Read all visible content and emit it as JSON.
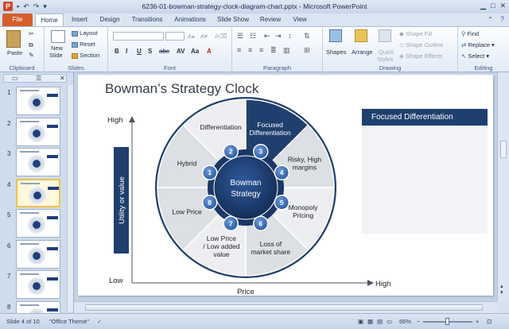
{
  "app": {
    "window_title": "6236-01-bowman-strategy-clock-diagram-chart.pptx - Microsoft PowerPoint",
    "logo": "P"
  },
  "tabs": [
    "File",
    "Home",
    "Insert",
    "Design",
    "Transitions",
    "Animations",
    "Slide Show",
    "Review",
    "View"
  ],
  "ribbon": {
    "clipboard": {
      "paste": "Paste",
      "group": "Clipboard"
    },
    "slides": {
      "new_slide_1": "New",
      "new_slide_2": "Slide",
      "layout": "Layout",
      "reset": "Reset",
      "section": "Section",
      "group": "Slides"
    },
    "font": {
      "group": "Font"
    },
    "paragraph": {
      "group": "Paragraph"
    },
    "drawing": {
      "shapes": "Shapes",
      "arrange": "Arrange",
      "quick_styles_1": "Quick",
      "quick_styles_2": "Styles",
      "shape_fill": "Shape Fill",
      "shape_outline": "Shape Outline",
      "shape_effects": "Shape Effects",
      "group": "Drawing"
    },
    "editing": {
      "find": "Find",
      "replace": "Replace",
      "select": "Select",
      "group": "Editing"
    }
  },
  "slides_panel": {
    "thumbnails": [
      {
        "num": "1",
        "selected": false
      },
      {
        "num": "2",
        "selected": false
      },
      {
        "num": "3",
        "selected": false
      },
      {
        "num": "4",
        "selected": true
      },
      {
        "num": "5",
        "selected": false
      },
      {
        "num": "6",
        "selected": false
      },
      {
        "num": "7",
        "selected": false
      },
      {
        "num": "8",
        "selected": false
      }
    ]
  },
  "slide": {
    "title": "Bowman’s Strategy Clock",
    "y_axis_label": "Utility or value",
    "y_high": "High",
    "y_low": "Low",
    "x_axis_label": "Price",
    "x_high": "High",
    "center_line1": "Bowman",
    "center_line2": "Strategy",
    "segments": {
      "s1": "Hybrid",
      "s2": "Differentiation",
      "s3_line1": "Focused",
      "s3_line2": "Differentiation",
      "s4_line1": "Risky, High",
      "s4_line2": "margins",
      "s5_line1": "Monopoly",
      "s5_line2": "Pricing",
      "s6_line1": "Loss of",
      "s6_line2": "market share",
      "s7_line1": "Low Price",
      "s7_line2": "/ Low added",
      "s7_line3": "value",
      "s8": "Low Price"
    },
    "numbers": [
      "1",
      "2",
      "3",
      "4",
      "5",
      "6",
      "7",
      "8"
    ],
    "side_box_title": "Focused Differentiation"
  },
  "status": {
    "slide_of": "Slide 4 of 10",
    "theme": "\"Office Theme\"",
    "zoom": "66%"
  },
  "colors": {
    "accent_dark": "#1f3f6e",
    "node_blue": "#2f63b0",
    "file_tab": "#d45f2a"
  }
}
